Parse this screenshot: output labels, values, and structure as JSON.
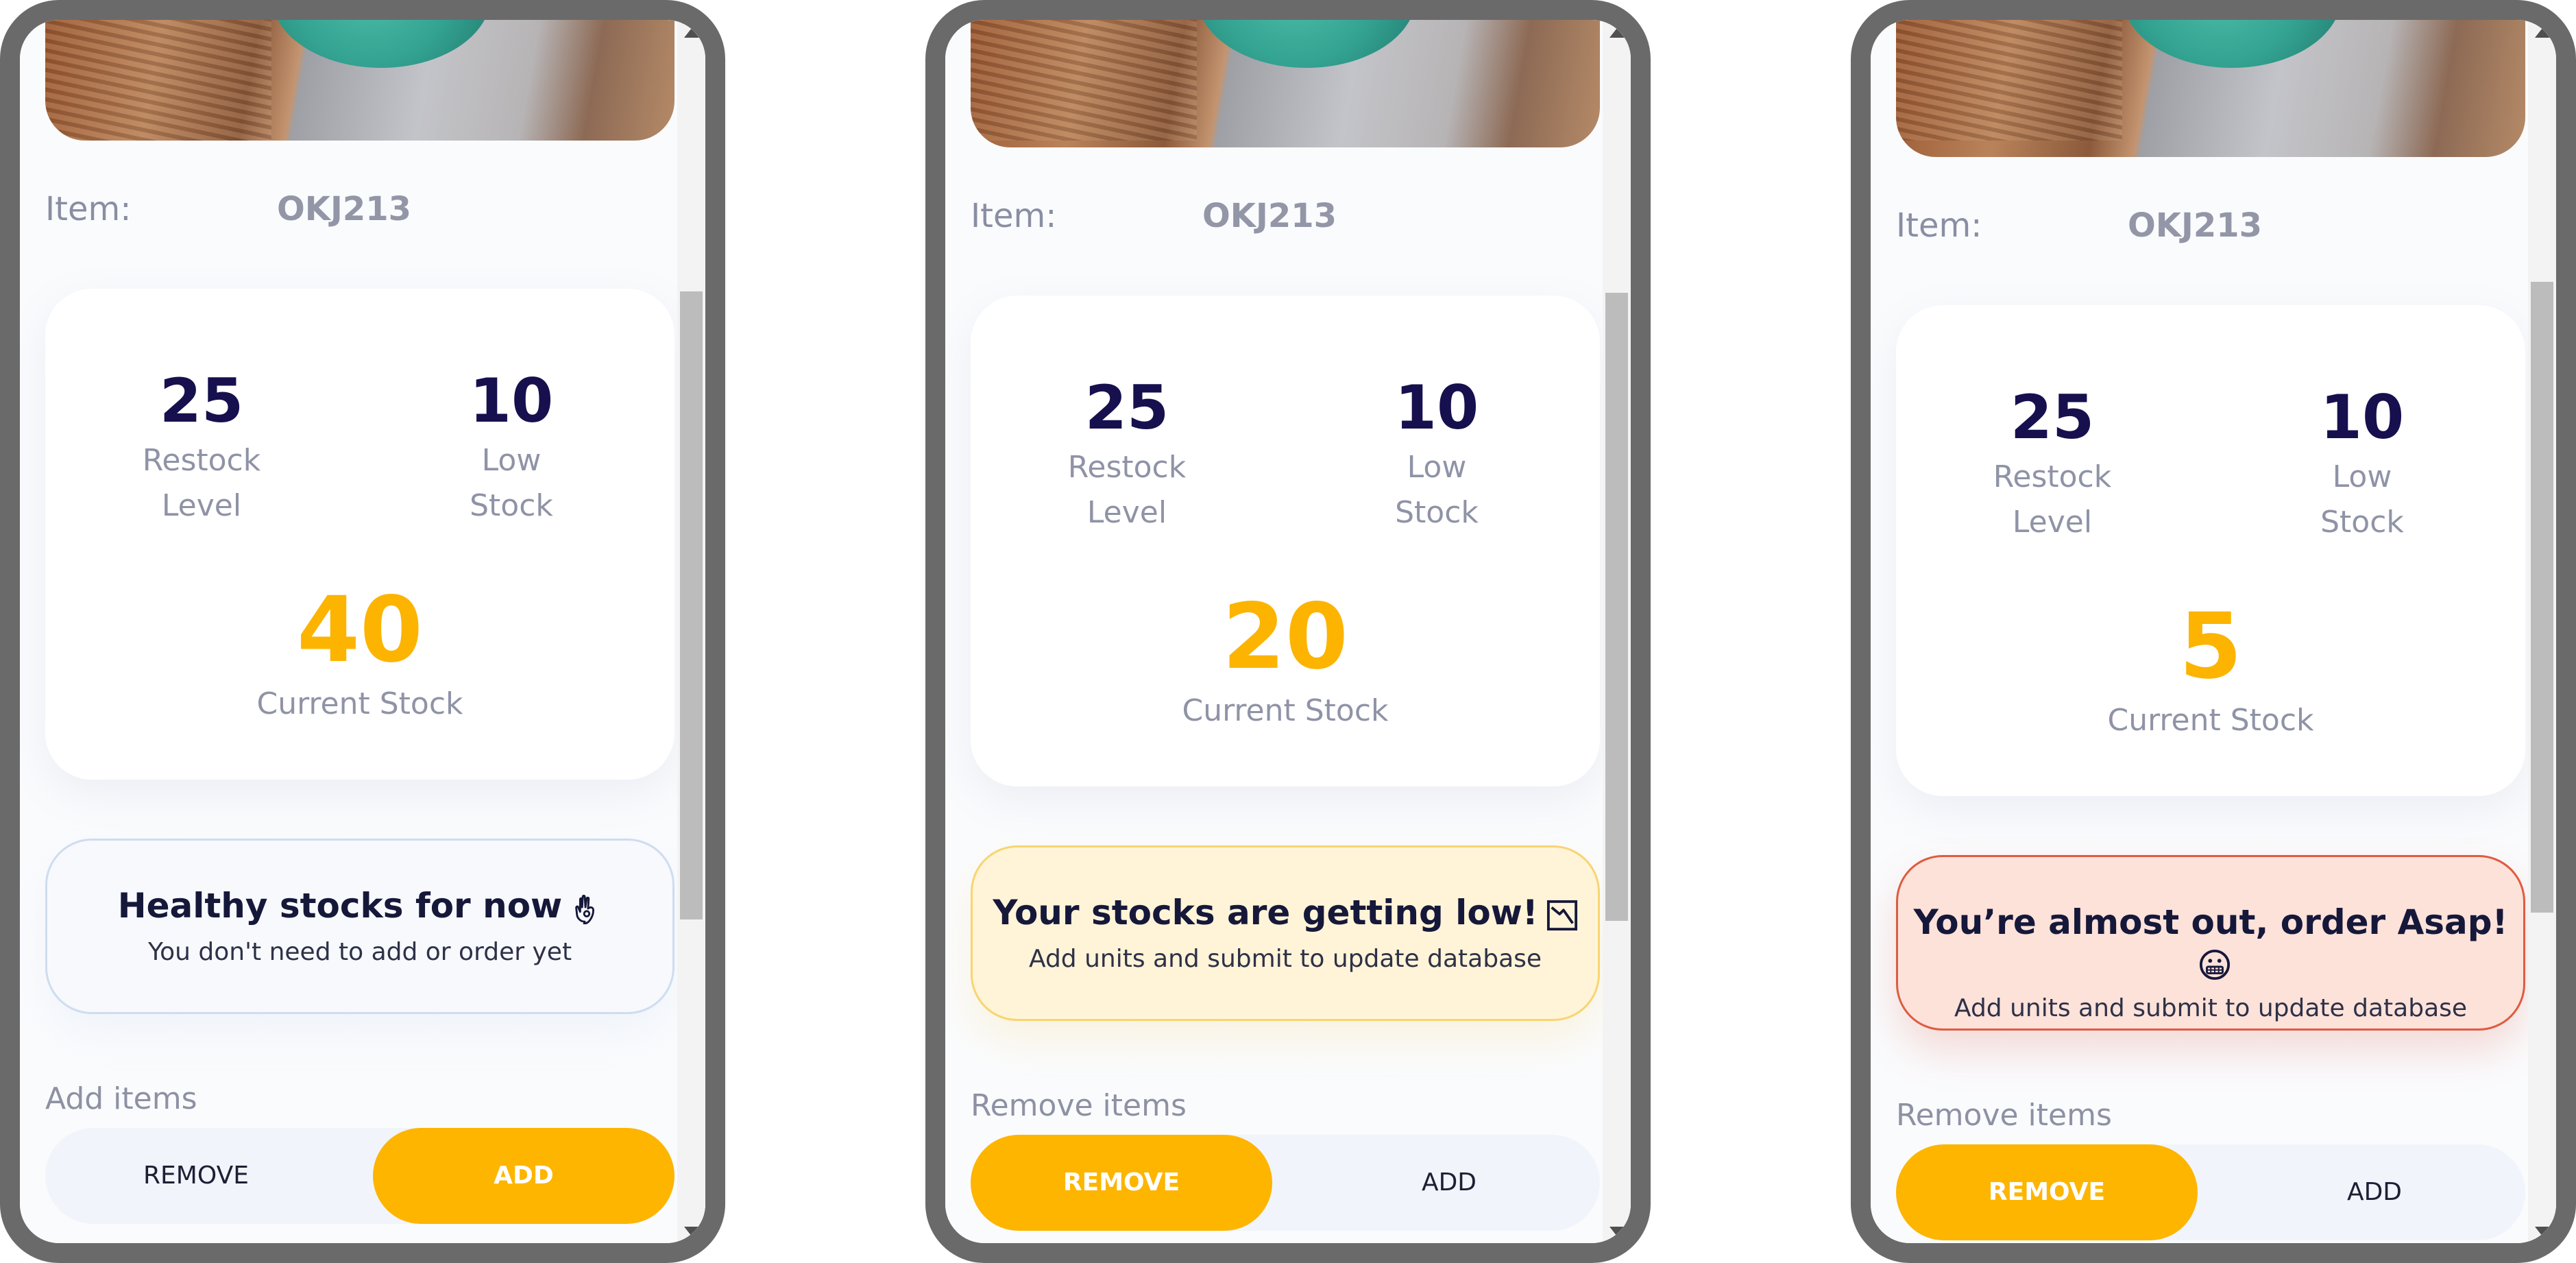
{
  "screens": [
    {
      "item_label": "Item:",
      "item_code": "OKJ213",
      "restock": {
        "value": "25",
        "label_line1": "Restock",
        "label_line2": "Level"
      },
      "low": {
        "value": "10",
        "label_line1": "Low",
        "label_line2": "Stock"
      },
      "current": {
        "value": "40",
        "label": "Current Stock"
      },
      "alert": {
        "title": "Healthy stocks for now",
        "subtitle": "You don't need to add or order yet",
        "icon": "ok-hand-icon",
        "bg": "#f7f9fd",
        "border": "#cfdcf0"
      },
      "section_label": "Add items",
      "toggle": {
        "remove": "REMOVE",
        "add": "ADD",
        "active": "add"
      }
    },
    {
      "item_label": "Item:",
      "item_code": "OKJ213",
      "restock": {
        "value": "25",
        "label_line1": "Restock",
        "label_line2": "Level"
      },
      "low": {
        "value": "10",
        "label_line1": "Low",
        "label_line2": "Stock"
      },
      "current": {
        "value": "20",
        "label": "Current Stock"
      },
      "alert": {
        "title": "Your stocks are getting low!",
        "subtitle": "Add units and submit to update database",
        "icon": "chart-down-icon",
        "bg": "#fff4d8",
        "border": "#f8d572"
      },
      "section_label": "Remove items",
      "toggle": {
        "remove": "REMOVE",
        "add": "ADD",
        "active": "remove"
      }
    },
    {
      "item_label": "Item:",
      "item_code": "OKJ213",
      "restock": {
        "value": "25",
        "label_line1": "Restock",
        "label_line2": "Level"
      },
      "low": {
        "value": "10",
        "label_line1": "Low",
        "label_line2": "Stock"
      },
      "current": {
        "value": "5",
        "label": "Current Stock"
      },
      "alert": {
        "title": "You’re almost out, order Asap!",
        "subtitle": "Add units and submit to update database",
        "icon": "grimace-face-icon",
        "bg": "#fde2da",
        "border": "#de5c40"
      },
      "section_label": "Remove items",
      "toggle": {
        "remove": "REMOVE",
        "add": "ADD",
        "active": "remove"
      }
    }
  ],
  "colors": {
    "accent": "#fcb400",
    "navy": "#16104e",
    "muted": "#8f93a6"
  }
}
